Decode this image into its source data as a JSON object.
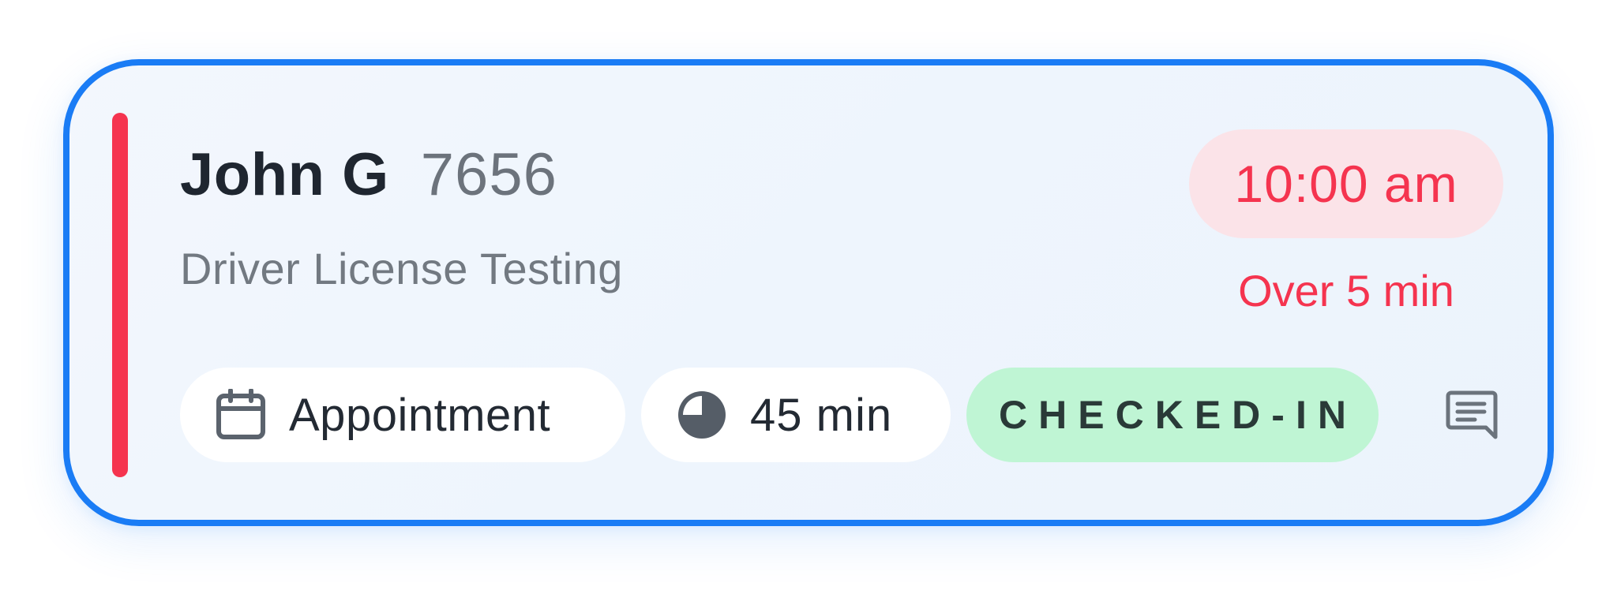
{
  "card": {
    "customer_name": "John G",
    "customer_id": "7656",
    "service": "Driver License Testing",
    "time": "10:00 am",
    "overdue": "Over 5 min",
    "visit_type": "Appointment",
    "duration": "45 min",
    "status": "CHECKED-IN",
    "icons": {
      "visit_type": "calendar-icon",
      "duration": "pie-timer-icon",
      "message": "message-icon"
    },
    "colors": {
      "card_border": "#1a7cf5",
      "status_indicator": "#f5344f",
      "late_time_background": "#fbe3e8",
      "late_time_text": "#f5344f",
      "status_background": "#bff5d4",
      "status_text": "#2a3a38"
    }
  }
}
